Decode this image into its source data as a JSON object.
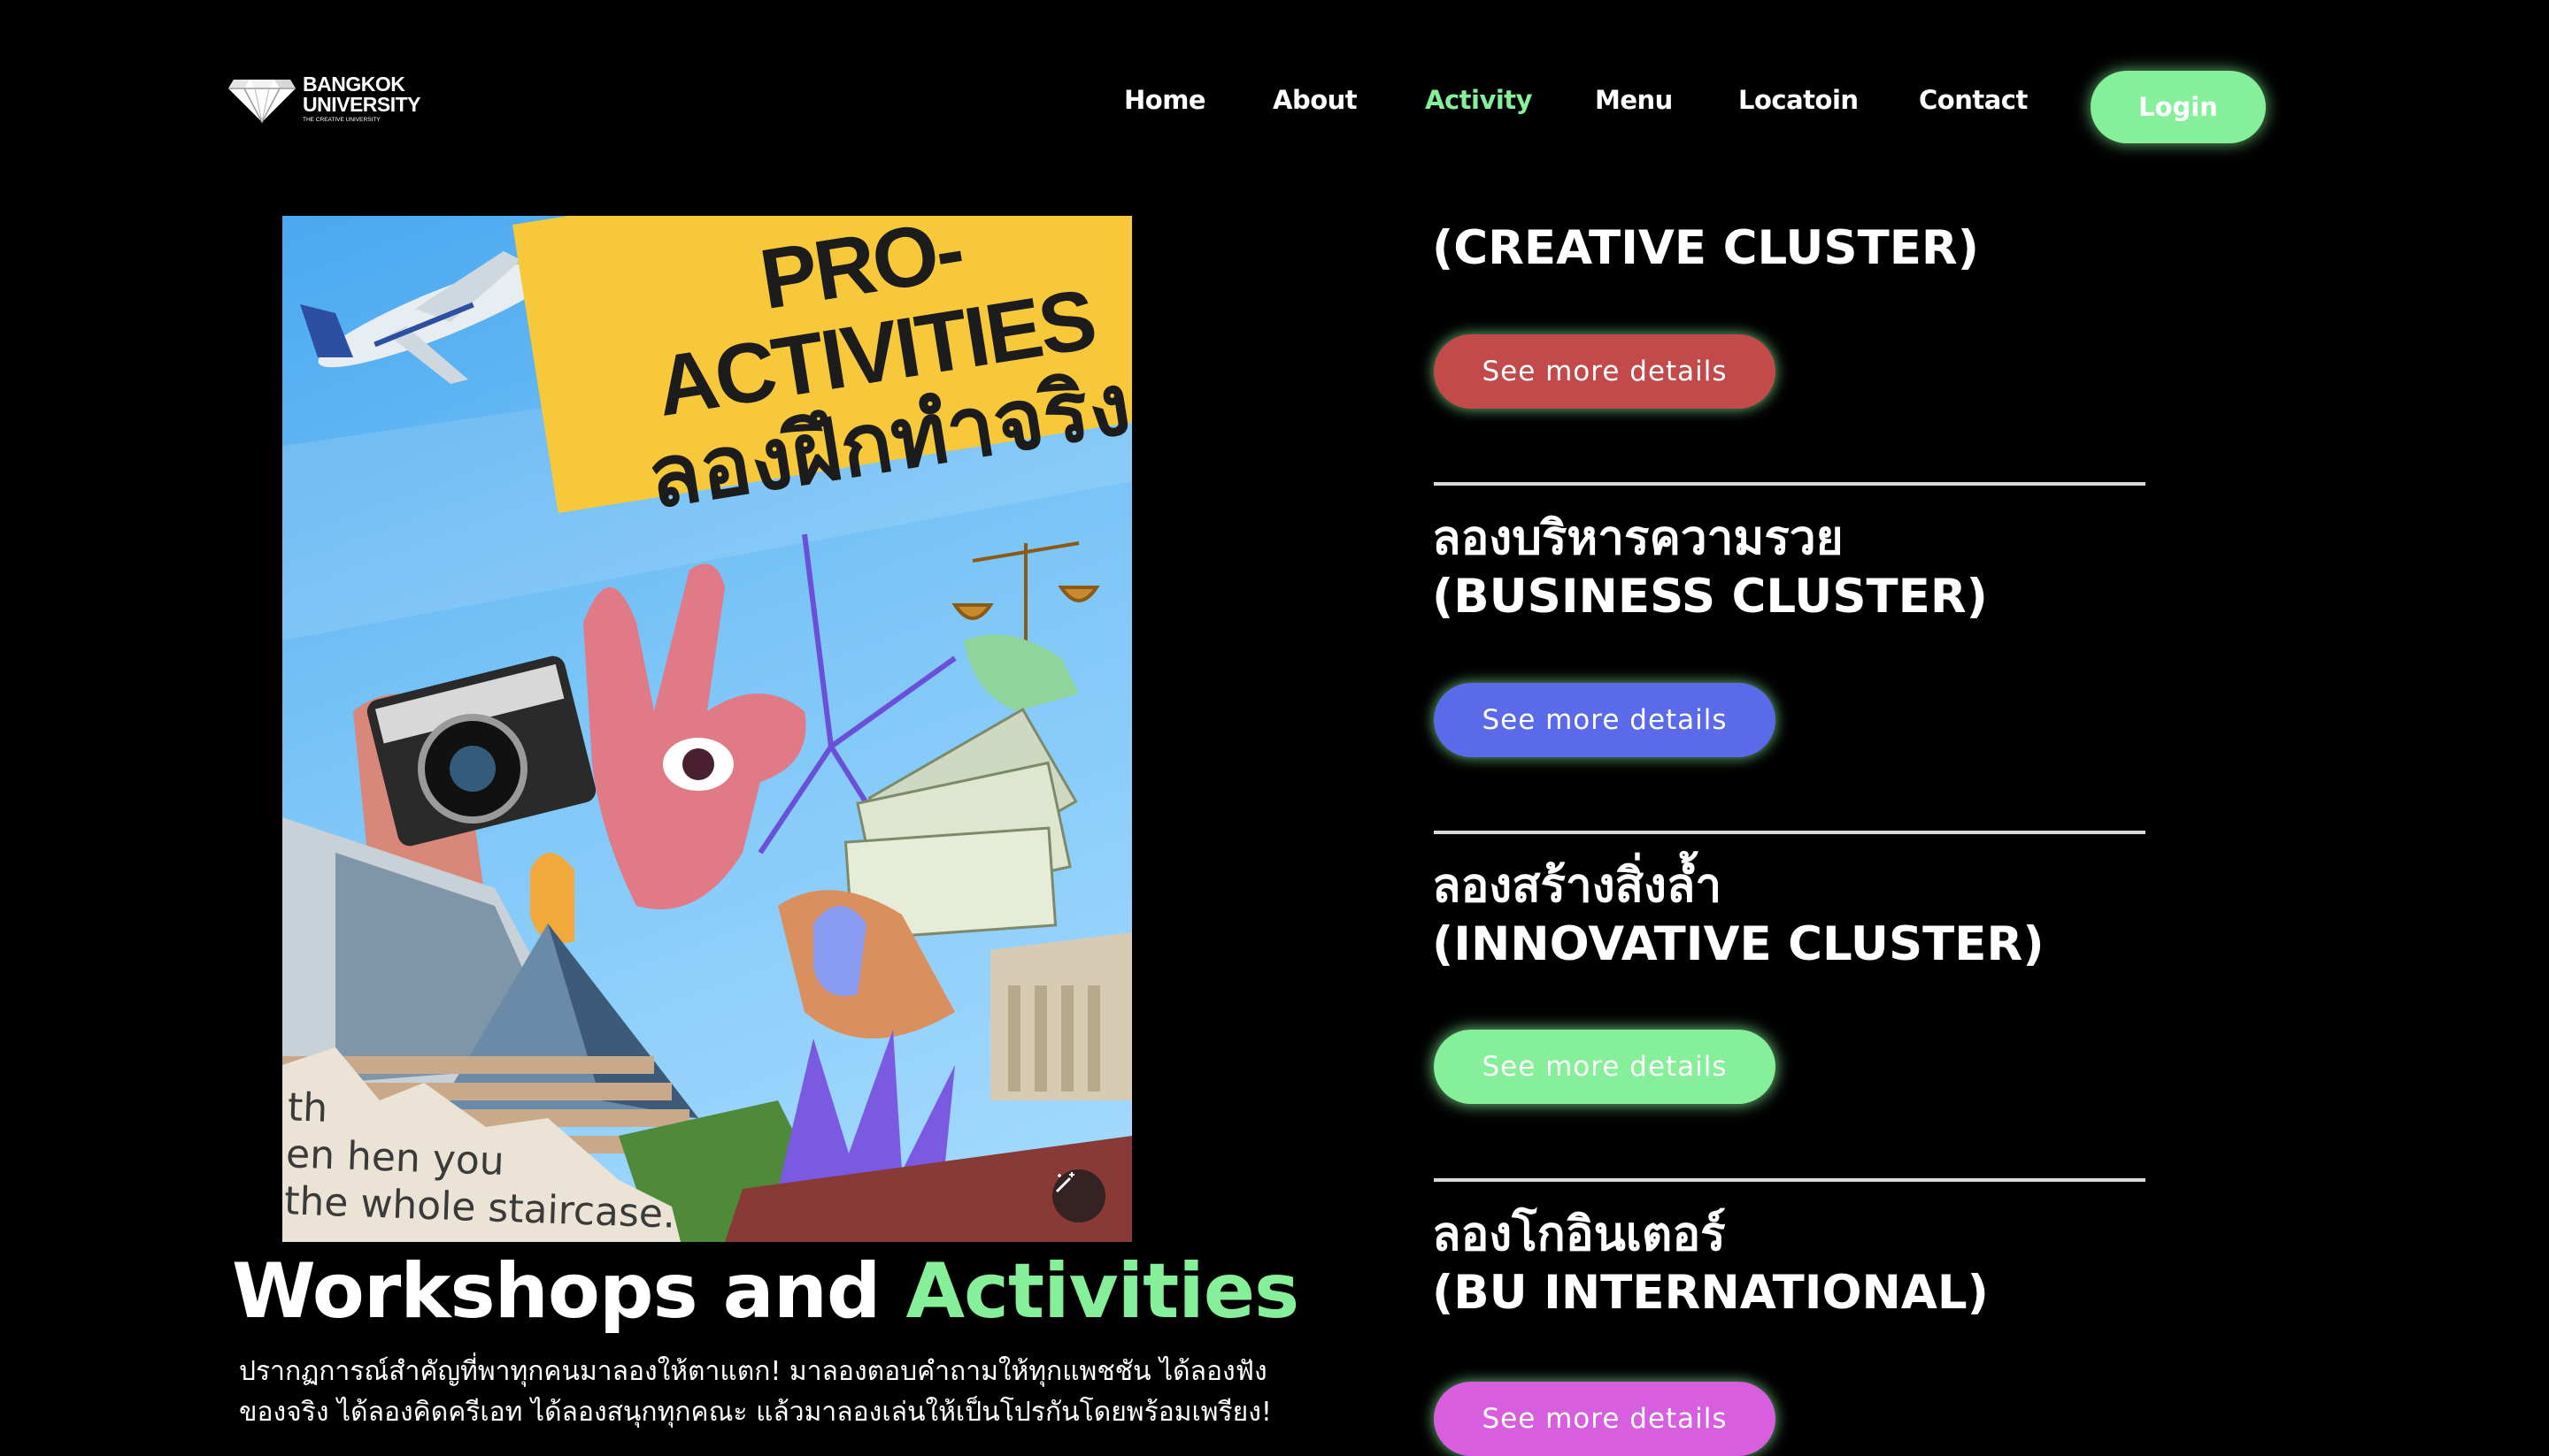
{
  "header": {
    "logo": {
      "line1": "BANGKOK",
      "line2": "UNIVERSITY",
      "tagline": "THE CREATIVE UNIVERSITY"
    },
    "nav": [
      {
        "label": "Home",
        "active": false
      },
      {
        "label": "About",
        "active": false
      },
      {
        "label": "Activity",
        "active": true
      },
      {
        "label": "Menu",
        "active": false
      },
      {
        "label": "Locatoin",
        "active": false
      },
      {
        "label": "Contact",
        "active": false
      }
    ],
    "login_label": "Login"
  },
  "poster": {
    "title_en": "PRO-ACTIVITIES",
    "title_th": "ลองฝึกทำจริง",
    "corner_text": [
      "th",
      "en   hen you",
      "the whole staircase."
    ],
    "edit_icon": "magic-wand-icon"
  },
  "section": {
    "heading_plain": "Workshops and ",
    "heading_accent": "Activities",
    "description": "ปรากฏการณ์สำคัญที่พาทุกคนมาลองให้ตาแตก! มาลองตอบคำถามให้ทุกแพชชัน ได้ลองฟังของจริง ได้ลองคิดครีเอท ได้ลองสนุกทุกคณะ แล้วมาลองเล่นให้เป็นโปรกันโดยพร้อมเพรียง!"
  },
  "clusters": [
    {
      "title_th": "",
      "title_en": "(CREATIVE CLUSTER)",
      "button_label": "See more details",
      "button_color": "#c24a4a"
    },
    {
      "title_th": "ลองบริหารความรวย",
      "title_en": "(BUSINESS CLUSTER)",
      "button_label": "See more details",
      "button_color": "#5b6ae8"
    },
    {
      "title_th": "ลองสร้างสิ่งล้ำ",
      "title_en": "(INNOVATIVE CLUSTER)",
      "button_label": "See more details",
      "button_color": "#86ef9a"
    },
    {
      "title_th": "ลองโกอินเตอร์",
      "title_en": "(BU INTERNATIONAL)",
      "button_label": "See more details",
      "button_color": "#d85ee0"
    }
  ],
  "colors": {
    "background": "#000000",
    "accent": "#86ef9a",
    "glow": "#86ef9a"
  }
}
